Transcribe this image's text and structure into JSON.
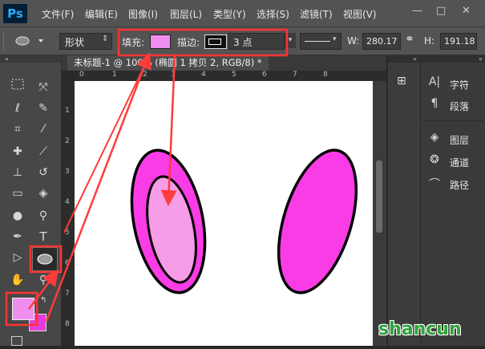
{
  "app": {
    "logo": "Ps"
  },
  "menus": [
    "文件(F)",
    "编辑(E)",
    "图像(I)",
    "图层(L)",
    "类型(Y)",
    "选择(S)",
    "滤镜(T)",
    "视图(V)"
  ],
  "window_controls": {
    "minimize": "—",
    "restore": "□",
    "close": "✕"
  },
  "options": {
    "mode": "形状",
    "fill_label": "填充:",
    "fill_color": "#f08ef0",
    "stroke_label": "描边:",
    "stroke_width": "3 点",
    "w_label": "W:",
    "w_value": "280.17",
    "h_label": "H:",
    "h_value": "191.18"
  },
  "document": {
    "tab_title": "未标题-1 @ 100% (椭圆 1 拷贝 2, RGB/8) *"
  },
  "rulers": {
    "h": [
      "0",
      "1",
      "2",
      "3",
      "4",
      "5",
      "6",
      "7",
      "8"
    ],
    "v": [
      "1",
      "2",
      "3",
      "4",
      "5",
      "6",
      "7",
      "8"
    ]
  },
  "tools": {
    "type_tool": "T"
  },
  "colors": {
    "foreground": "#f08ef0",
    "background": "#e83ad6",
    "outer_ellipse": "#fa3ce6",
    "inner_ellipse": "#f79ce6",
    "highlight": "#ff3333"
  },
  "panels": [
    {
      "icon": "character-icon",
      "label": "字符"
    },
    {
      "icon": "paragraph-icon",
      "label": "段落"
    },
    {
      "icon": "layers-icon",
      "label": "图层"
    },
    {
      "icon": "channels-icon",
      "label": "通道"
    },
    {
      "icon": "paths-icon",
      "label": "路径"
    }
  ],
  "watermark": "shancun"
}
